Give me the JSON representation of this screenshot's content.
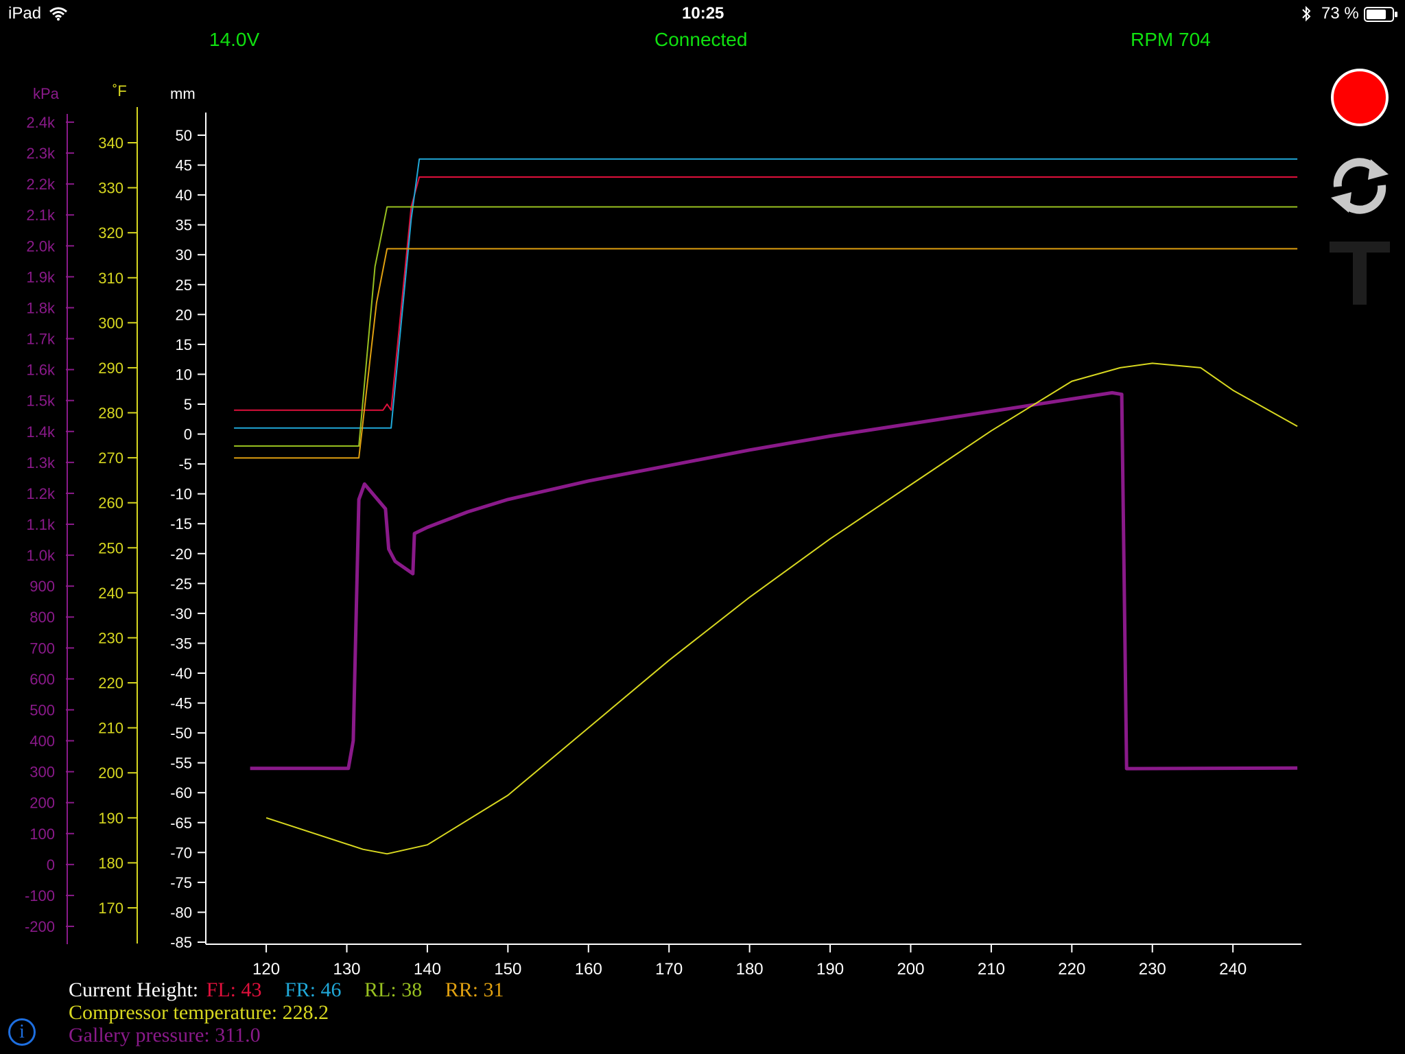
{
  "status_bar": {
    "device": "iPad",
    "time": "10:25",
    "battery": "73 %"
  },
  "header": {
    "voltage": "14.0V",
    "connection": "Connected",
    "rpm": "RPM 704"
  },
  "colors": {
    "kpa": "#8a1a8a",
    "temp": "#d8d820",
    "fl": "#e0103c",
    "fr": "#20a8d8",
    "rl": "#98c020",
    "rr": "#e0a010",
    "gallery": "#8a1a8a",
    "header_green": "#10e010",
    "record": "#ff0000"
  },
  "icons": {
    "record": "record-button",
    "refresh": "refresh-icon",
    "text": "text-t-icon",
    "info": "info-icon",
    "wifi": "wifi-icon",
    "bluetooth": "bluetooth-icon",
    "battery": "battery-icon"
  },
  "chart_data": {
    "type": "line",
    "title": "",
    "xlabel": "",
    "axes": {
      "kpa": {
        "label": "kPa",
        "ticks": [
          "2.4k",
          "2.3k",
          "2.2k",
          "2.1k",
          "2.0k",
          "1.9k",
          "1.8k",
          "1.7k",
          "1.6k",
          "1.5k",
          "1.4k",
          "1.3k",
          "1.2k",
          "1.1k",
          "1.0k",
          "900",
          "800",
          "700",
          "600",
          "500",
          "400",
          "300",
          "200",
          "100",
          "0",
          "-100",
          "-200"
        ],
        "range": [
          -200,
          2400
        ]
      },
      "temp": {
        "label": "˚F",
        "ticks": [
          "340",
          "330",
          "320",
          "310",
          "300",
          "290",
          "280",
          "270",
          "260",
          "250",
          "240",
          "230",
          "220",
          "210",
          "200",
          "190",
          "180",
          "170"
        ],
        "range": [
          170,
          340
        ]
      },
      "mm": {
        "label": "mm",
        "ticks": [
          "50",
          "45",
          "40",
          "35",
          "30",
          "25",
          "20",
          "15",
          "10",
          "5",
          "0",
          "-5",
          "-10",
          "-15",
          "-20",
          "-25",
          "-30",
          "-35",
          "-40",
          "-45",
          "-50",
          "-55",
          "-60",
          "-65",
          "-70",
          "-75",
          "-80",
          "-85"
        ],
        "range": [
          -85,
          50
        ]
      },
      "x": {
        "ticks": [
          "120",
          "130",
          "140",
          "150",
          "160",
          "170",
          "180",
          "190",
          "200",
          "210",
          "220",
          "230",
          "240"
        ],
        "range": [
          112.5,
          248.5
        ]
      }
    },
    "series": [
      {
        "name": "FL",
        "axis": "mm",
        "points": [
          [
            116,
            4
          ],
          [
            134.5,
            4
          ],
          [
            135,
            5
          ],
          [
            135.5,
            4
          ],
          [
            138,
            38
          ],
          [
            139,
            43
          ],
          [
            248,
            43
          ]
        ]
      },
      {
        "name": "FR",
        "axis": "mm",
        "points": [
          [
            116,
            1
          ],
          [
            135.5,
            1
          ],
          [
            138,
            36
          ],
          [
            139,
            46
          ],
          [
            248,
            46
          ]
        ]
      },
      {
        "name": "RL",
        "axis": "mm",
        "points": [
          [
            116,
            -2
          ],
          [
            131.5,
            -2
          ],
          [
            133.5,
            28
          ],
          [
            135,
            38
          ],
          [
            248,
            38
          ]
        ]
      },
      {
        "name": "RR",
        "axis": "mm",
        "points": [
          [
            116,
            -4
          ],
          [
            131.5,
            -4
          ],
          [
            133.7,
            22
          ],
          [
            135,
            31
          ],
          [
            248,
            31
          ]
        ]
      },
      {
        "name": "Gallery pressure",
        "axis": "kpa",
        "points": [
          [
            118,
            311
          ],
          [
            130.2,
            311
          ],
          [
            130.8,
            400
          ],
          [
            131.5,
            1180
          ],
          [
            132.2,
            1230
          ],
          [
            134.8,
            1150
          ],
          [
            135.2,
            1020
          ],
          [
            136,
            980
          ],
          [
            138.2,
            940
          ],
          [
            138.4,
            1070
          ],
          [
            140,
            1090
          ],
          [
            145,
            1140
          ],
          [
            150,
            1180
          ],
          [
            160,
            1240
          ],
          [
            170,
            1290
          ],
          [
            180,
            1340
          ],
          [
            190,
            1385
          ],
          [
            200,
            1425
          ],
          [
            210,
            1465
          ],
          [
            220,
            1505
          ],
          [
            225,
            1525
          ],
          [
            226.2,
            1520
          ],
          [
            226.8,
            310
          ],
          [
            248,
            312
          ]
        ]
      },
      {
        "name": "Compressor temperature",
        "axis": "temp",
        "points": [
          [
            120,
            190
          ],
          [
            132,
            183
          ],
          [
            135,
            182
          ],
          [
            140,
            184
          ],
          [
            150,
            195
          ],
          [
            160,
            210
          ],
          [
            170,
            225
          ],
          [
            180,
            239
          ],
          [
            190,
            252
          ],
          [
            200,
            264
          ],
          [
            210,
            276
          ],
          [
            220,
            287
          ],
          [
            226,
            290
          ],
          [
            230,
            291
          ],
          [
            236,
            290
          ],
          [
            240,
            285
          ],
          [
            248,
            277
          ]
        ]
      }
    ],
    "current_height": {
      "label": "Current Height:",
      "FL": "FL: 43",
      "FR": "FR: 46",
      "RL": "RL: 38",
      "RR": "RR: 31"
    },
    "compressor_temperature": "Compressor temperature: 228.2",
    "gallery_pressure": "Gallery pressure: 311.0"
  }
}
